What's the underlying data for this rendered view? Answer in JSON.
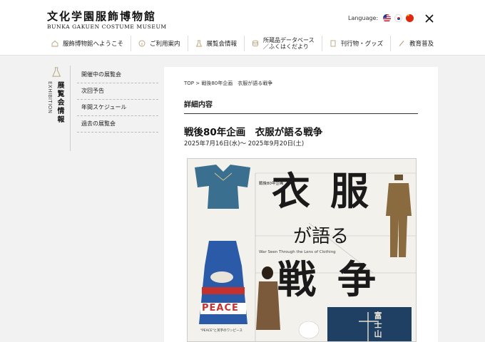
{
  "header": {
    "logo_jp": "文化学園服飾博物館",
    "logo_en": "BUNKA GAKUEN COSTUME MUSEUM",
    "language_label": "Language:",
    "nav": [
      {
        "label": "服飾博物館へようこそ",
        "icon": "house-icon"
      },
      {
        "label": "ご利用案内",
        "icon": "info-icon"
      },
      {
        "label": "展覧会情報",
        "icon": "dress-icon"
      },
      {
        "label_1": "所蔵品データベース",
        "label_2": "／ふくはくだより",
        "icon": "database-icon"
      },
      {
        "label": "刊行物・グッズ",
        "icon": "book-icon"
      },
      {
        "label": "教育普及",
        "icon": "pen-icon"
      }
    ]
  },
  "sidebar": {
    "title_jp": "展覧会情報",
    "title_en": "EXHIBITION",
    "items": [
      "開催中の展覧会",
      "次回予告",
      "年間スケジュール",
      "過去の展覧会"
    ]
  },
  "main": {
    "breadcrumb": "TOP >  戦後80年企画　衣服が語る戦争",
    "section_title": "詳細内容",
    "exhibition_title": "戦後80年企画　衣服が語る戦争",
    "dates": "2025年7月16日(水)～ 2025年9月20日(土)"
  },
  "poster": {
    "tag": "戦後80年企画",
    "char_1": "衣",
    "char_2": "服",
    "ga_kataru": "が語る",
    "subtitle_en": "War Seen Through the Lens of Clothing",
    "char_3": "戦",
    "char_4": "争",
    "peace": "PEACE",
    "banner_chars": "富士山",
    "caption_peace": "\"PEACE\"と英字のワンピース",
    "colors": {
      "banner": "#1f3f63",
      "dress_blue": "#2b5aa8",
      "peace_red": "#c5312e",
      "kimono": "#3b6f8f"
    }
  }
}
